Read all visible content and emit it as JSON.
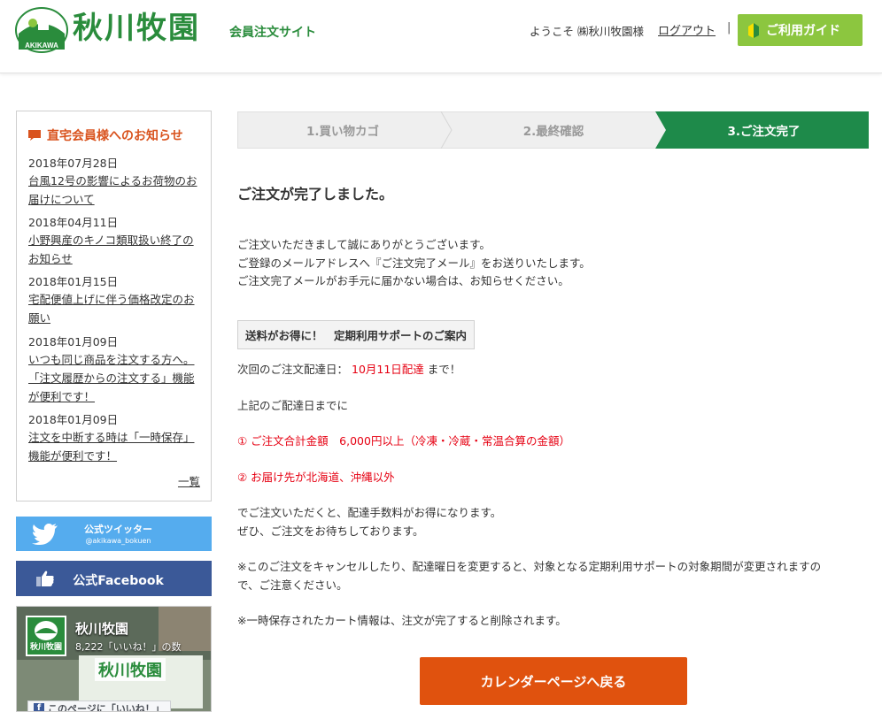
{
  "header": {
    "logo_caption": "AKIKAWA",
    "brand": "秋川牧園",
    "site_name": "会員注文サイト",
    "welcome": "ようこそ ㈱秋川牧園様",
    "logout_label": "ログアウト",
    "separator": "|",
    "guide_label": "ご利用ガイド",
    "brand_color": "#2a8c3c",
    "guide_color": "#8cc63f"
  },
  "sidebar": {
    "news_title": "直宅会員様へのお知らせ",
    "news_title_color": "#d9531e",
    "news": [
      {
        "date": "2018年07月28日",
        "title": "台風12号の影響によるお荷物のお届けについて"
      },
      {
        "date": "2018年04月11日",
        "title": "小野興産のキノコ類取扱い終了のお知らせ"
      },
      {
        "date": "2018年01月15日",
        "title": "宅配便値上げに伴う価格改定のお願い"
      },
      {
        "date": "2018年01月09日",
        "title": "いつも同じ商品を注文する方へ。「注文履歴からの注文する」機能が便利です！"
      },
      {
        "date": "2018年01月09日",
        "title": "注文を中断する時は「一時保存」機能が便利です！"
      }
    ],
    "more_label": "一覧",
    "twitter": {
      "label": "公式ツイッター",
      "handle": "@akikawa_bokuen",
      "color": "#55acee"
    },
    "facebook": {
      "label": "公式Facebook",
      "color": "#3b5998"
    },
    "fb_widget": {
      "page_name": "秋川牧園",
      "logo_caption": "秋川牧園",
      "likes": "8,222「いいね！」の数",
      "banner": "秋川牧園",
      "like_button": "このページに「いいね！」"
    }
  },
  "steps": [
    {
      "label": "1.買い物カゴ",
      "active": false
    },
    {
      "label": "2.最終確認",
      "active": false
    },
    {
      "label": "3.ご注文完了",
      "active": true
    }
  ],
  "main": {
    "title": "ご注文が完了しました。",
    "thanks": [
      "ご注文いただきまして誠にありがとうございます。",
      "ご登録のメールアドレスへ『ご注文完了メール』をお送りいたします。",
      "ご注文完了メールがお手元に届かない場合は、お知らせください。"
    ],
    "notice_title": "送料がお得に！　定期利用サポートのご案内",
    "next_prefix": "次回のご注文配達日：",
    "next_date": "10月11日配達",
    "next_suffix": "まで！",
    "until_line": "上記のご配達日までに",
    "condition1": "① ご注文合計金額　6,000円以上（冷凍・冷蔵・常温合算の金額）",
    "condition2": "② お届け先が北海道、沖縄以外",
    "benefit": [
      "でご注文いただくと、配達手数料がお得になります。",
      "ぜひ、ご注文をお待ちしております。"
    ],
    "cancel_note": [
      "※このご注文をキャンセルしたり、配達曜日を変更すると、対象となる定期利用サポートの対象期間が変更されますの",
      "で、ご注意ください。"
    ],
    "cart_note": "※一時保存されたカート情報は、注文が完了すると削除されます。",
    "back_button": "カレンダーページへ戻る",
    "back_color": "#e0520e",
    "accent_red": "#e60012"
  }
}
